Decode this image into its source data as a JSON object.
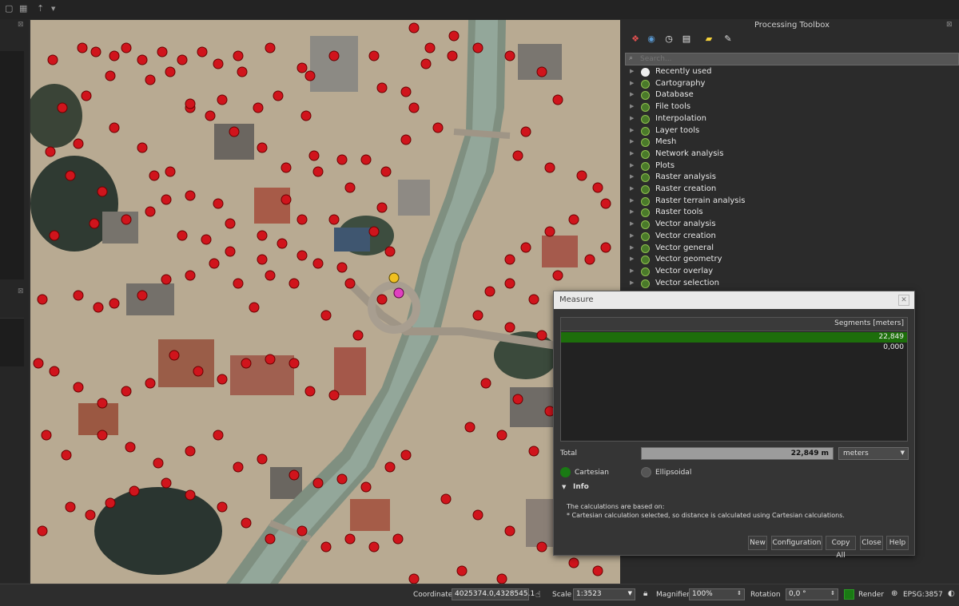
{
  "processing_toolbox": {
    "title": "Processing Toolbox",
    "search_placeholder": "Search...",
    "items": [
      {
        "label": "Recently used",
        "icon": "clock-icon"
      },
      {
        "label": "Cartography",
        "icon": "qgis-icon"
      },
      {
        "label": "Database",
        "icon": "qgis-icon"
      },
      {
        "label": "File tools",
        "icon": "qgis-icon"
      },
      {
        "label": "Interpolation",
        "icon": "qgis-icon"
      },
      {
        "label": "Layer tools",
        "icon": "qgis-icon"
      },
      {
        "label": "Mesh",
        "icon": "qgis-icon"
      },
      {
        "label": "Network analysis",
        "icon": "qgis-icon"
      },
      {
        "label": "Plots",
        "icon": "qgis-icon"
      },
      {
        "label": "Raster analysis",
        "icon": "qgis-icon"
      },
      {
        "label": "Raster creation",
        "icon": "qgis-icon"
      },
      {
        "label": "Raster terrain analysis",
        "icon": "qgis-icon"
      },
      {
        "label": "Raster tools",
        "icon": "qgis-icon"
      },
      {
        "label": "Vector analysis",
        "icon": "qgis-icon"
      },
      {
        "label": "Vector creation",
        "icon": "qgis-icon"
      },
      {
        "label": "Vector general",
        "icon": "qgis-icon"
      },
      {
        "label": "Vector geometry",
        "icon": "qgis-icon"
      },
      {
        "label": "Vector overlay",
        "icon": "qgis-icon"
      },
      {
        "label": "Vector selection",
        "icon": "qgis-icon"
      }
    ]
  },
  "measure": {
    "title": "Measure",
    "segments_header": "Segments [meters]",
    "segments": [
      "22,849",
      "0,000"
    ],
    "total_label": "Total",
    "total_value": "22,849 m",
    "unit": "meters",
    "cartesian_label": "Cartesian",
    "ellipsoidal_label": "Ellipsoidal",
    "info_label": "Info",
    "info_line1": "The calculations are based on:",
    "info_line2": "* Cartesian calculation selected, so distance is calculated using Cartesian calculations.",
    "buttons": {
      "new": "New",
      "configuration": "Configuration",
      "copy_all": "Copy All",
      "close": "Close",
      "help": "Help"
    }
  },
  "statusbar": {
    "coordinate_label": "Coordinate",
    "coordinate_value": "4025374.0,4328545.1",
    "scale_label": "Scale",
    "scale_value": "1:3523",
    "magnifier_label": "Magnifier",
    "magnifier_value": "100%",
    "rotation_label": "Rotation",
    "rotation_value": "0,0 °",
    "render_label": "Render",
    "crs_value": "EPSG:3857"
  },
  "colors": {
    "point_red": "#d0141c",
    "selected_row": "#1d6e0b",
    "cartesian_radio": "#1a7a14"
  }
}
